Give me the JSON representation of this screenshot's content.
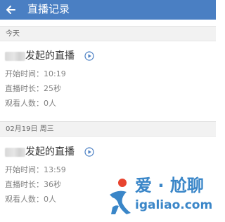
{
  "header": {
    "title": "直播记录",
    "back_icon": "back-arrow-icon",
    "background": "#4a7fc3"
  },
  "sections": [
    {
      "date_label": "今天",
      "record": {
        "title_suffix": "发起的直播",
        "start_time": "开始时间：10:19",
        "duration": "直播时长：25秒",
        "viewers": "观看人数：0人"
      }
    },
    {
      "date_label": "02月19日 周三",
      "record": {
        "title_suffix": "发起的直播",
        "start_time": "开始时间：13:59",
        "duration": "直播时长：36秒",
        "viewers": "观看人数：0人"
      }
    }
  ],
  "watermark": {
    "text": "爱 · 尬聊",
    "url": "igaliao.com",
    "color": "#3a86c8",
    "accent_color": "#e8442f"
  }
}
